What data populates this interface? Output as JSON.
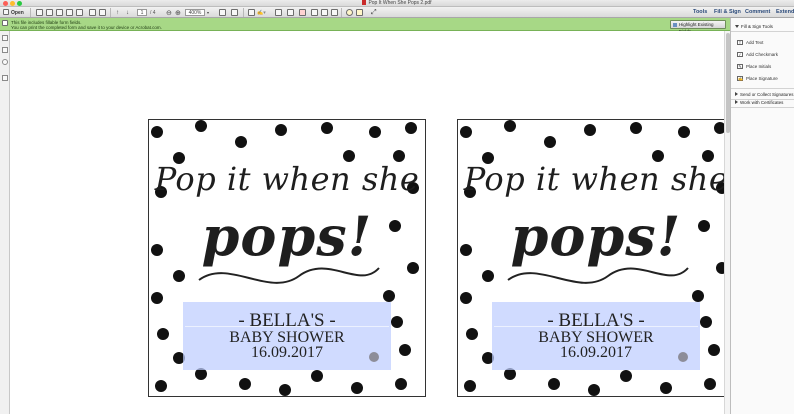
{
  "window": {
    "title": "Pop It When She Pops 2.pdf",
    "traffic_colors": [
      "#fc5f57",
      "#fdbc2e",
      "#28c840"
    ]
  },
  "toolbar": {
    "open_label": "Open",
    "page_number": "1",
    "page_total": "/ 4",
    "zoom": "400%",
    "tabs": {
      "tools": "Tools",
      "fill_sign": "Fill & Sign",
      "comment": "Comment",
      "extended": "Extende"
    }
  },
  "notice": {
    "line1": "This file includes fillable form fields.",
    "line2": "You can print the completed form and save it to your device or Acrobat.com.",
    "highlight_button": "Highlight Existing Fields"
  },
  "right_panel": {
    "section_title": "Fill & Sign Tools",
    "items": [
      {
        "label": "Add Text",
        "icon": "text-icon",
        "glyph": "T"
      },
      {
        "label": "Add Checkmark",
        "icon": "checkmark-icon",
        "glyph": "✓"
      },
      {
        "label": "Place Initials",
        "icon": "initials-icon",
        "glyph": "✎"
      },
      {
        "label": "Place Signature",
        "icon": "signature-icon",
        "glyph": "✍"
      }
    ],
    "sections": [
      {
        "label": "Send or Collect Signatures"
      },
      {
        "label": "Work with Certificates"
      }
    ]
  },
  "document": {
    "pages": [
      {
        "heading_line1": "Pop it when she",
        "heading_line2": "pops!",
        "field_line1": "- BELLA'S -",
        "field_line2": "BABY SHOWER",
        "field_line3": "16.09.2017"
      },
      {
        "heading_line1": "Pop it when she",
        "heading_line2": "pops!",
        "field_line1": "- BELLA'S -",
        "field_line2": "BABY SHOWER",
        "field_line3": "16.09.2017"
      }
    ],
    "colors": {
      "notice_bar": "#a7d886",
      "form_field_highlight": "#bec9ff",
      "polka_dot": "#111111"
    }
  }
}
